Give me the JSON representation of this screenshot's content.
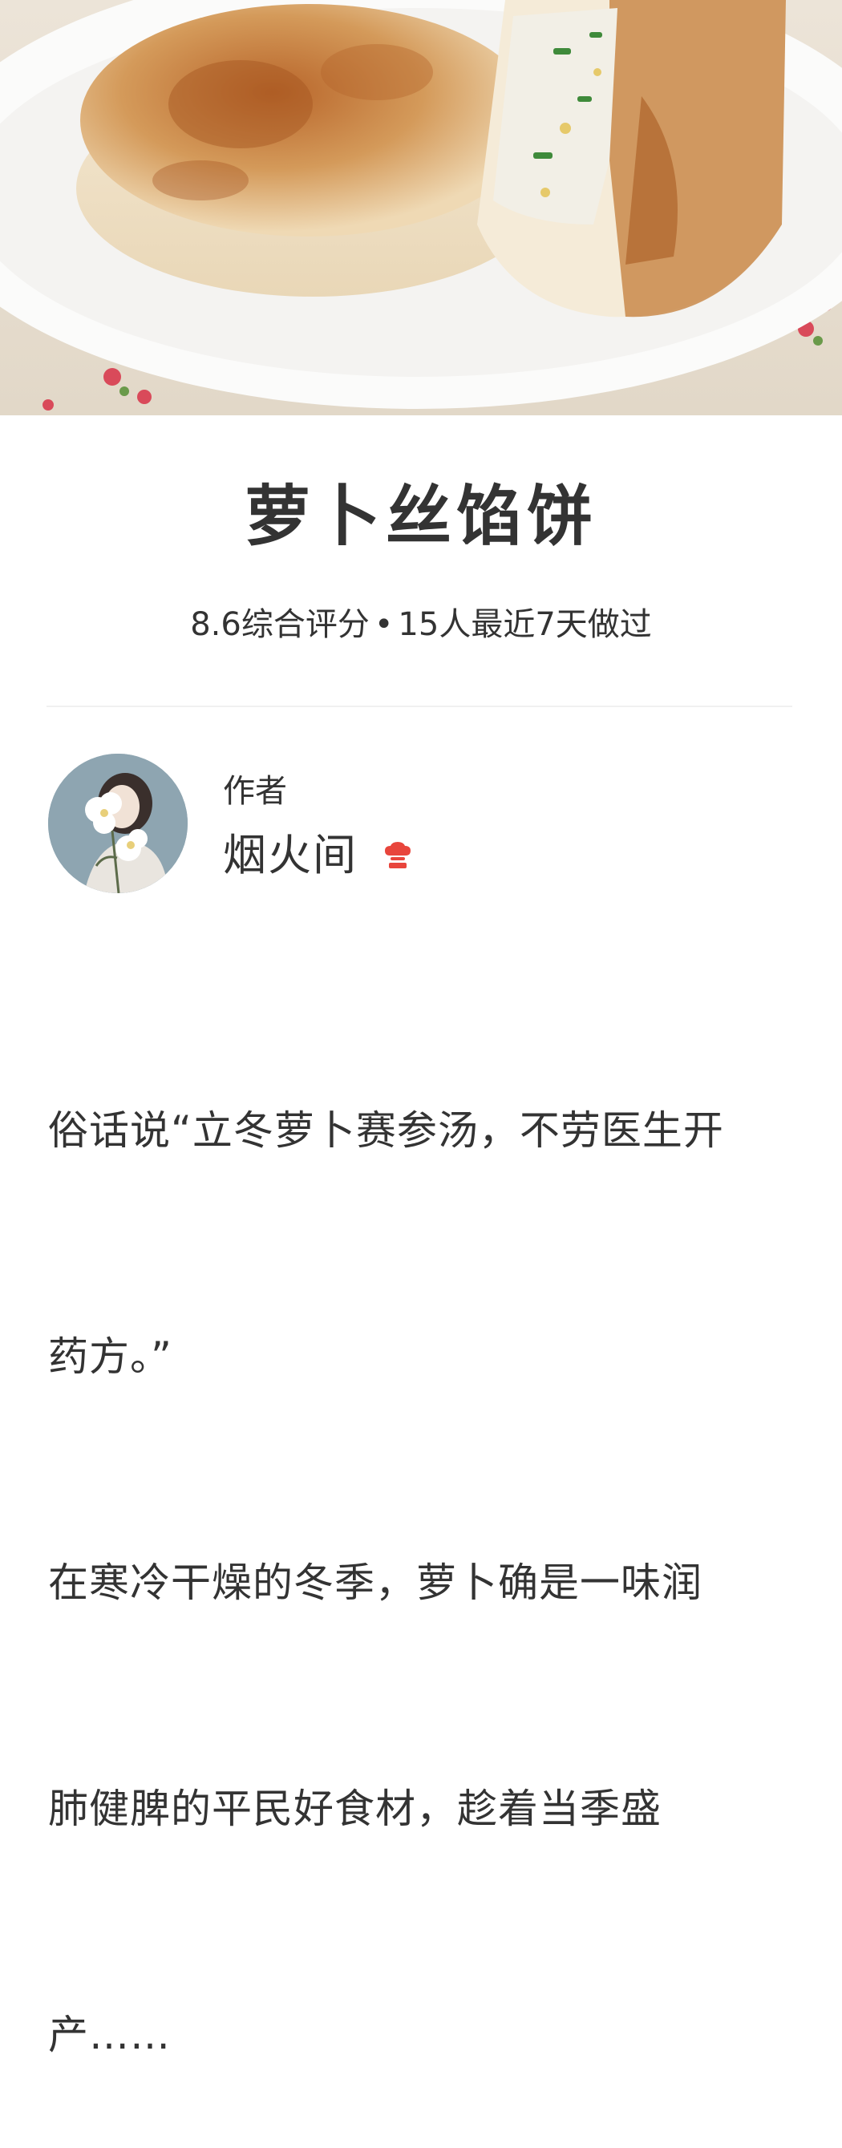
{
  "recipe": {
    "title": "萝卜丝馅饼",
    "rating": "8.6综合评分",
    "separator": "•",
    "cooked_recent": "15人最近7天做过"
  },
  "author": {
    "label": "作者",
    "name": "烟火间",
    "badge_icon": "chef-hat-icon",
    "badge_color": "#e8453c"
  },
  "description": {
    "lines": [
      "俗话说“立冬萝卜赛参汤，不劳医生开",
      "药方。”",
      "在寒冷干燥的冬季，萝卜确是一味润",
      "肺健脾的平民好食材，趁着当季盛",
      "产……"
    ]
  },
  "colors": {
    "text": "#333333",
    "accent": "#e8453c",
    "divider": "#f0f0f0"
  }
}
